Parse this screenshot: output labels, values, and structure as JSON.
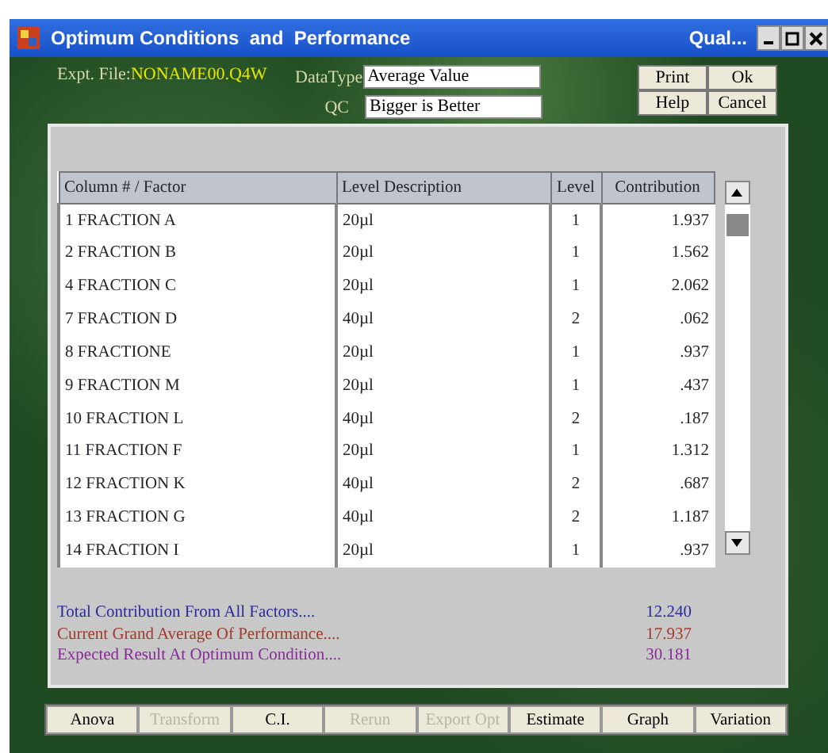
{
  "window": {
    "title": "Optimum Conditions  and  Performance",
    "title_right": "Qual..."
  },
  "header": {
    "file_label": "Expt. File:",
    "file_name": "NONAME00.Q4W",
    "datatype_label": "DataType",
    "datatype": "Average Value",
    "qc_label": "QC",
    "qc": "Bigger is Better"
  },
  "top_buttons": [
    "Print",
    "Ok",
    "Help",
    "Cancel"
  ],
  "table": {
    "columns": [
      "Column # / Factor",
      "Level Description",
      "Level",
      "Contribution"
    ],
    "rows": [
      [
        "1 FRACTION A",
        "20µl",
        "1",
        "1.937"
      ],
      [
        "2 FRACTION B",
        "20µl",
        "1",
        "1.562"
      ],
      [
        "4 FRACTION C",
        "20µl",
        "1",
        "2.062"
      ],
      [
        "7 FRACTION D",
        "40µl",
        "2",
        ".062"
      ],
      [
        "8 FRACTIONE",
        "20µl",
        "1",
        ".937"
      ],
      [
        "9 FRACTION M",
        "20µl",
        "1",
        ".437"
      ],
      [
        "10 FRACTION L",
        "40µl",
        "2",
        ".187"
      ],
      [
        "11 FRACTION F",
        "20µl",
        "1",
        "1.312"
      ],
      [
        "12 FRACTION K",
        "40µl",
        "2",
        ".687"
      ],
      [
        "13 FRACTION G",
        "40µl",
        "2",
        "1.187"
      ],
      [
        "14 FRACTION I",
        "20µl",
        "1",
        ".937"
      ]
    ]
  },
  "summary": [
    {
      "label": "Total Contribution From All Factors....",
      "value": "12.240",
      "color": "#2a2a9a"
    },
    {
      "label": "Current Grand Average Of Performance....",
      "value": "17.937",
      "color": "#a03a2a"
    },
    {
      "label": "Expected Result At Optimum Condition....",
      "value": "30.181",
      "color": "#8a2a9a"
    }
  ],
  "bottom_buttons": [
    {
      "label": "Anova",
      "disabled": false
    },
    {
      "label": "Transform",
      "disabled": true
    },
    {
      "label": "C.I.",
      "disabled": false
    },
    {
      "label": "Rerun",
      "disabled": true
    },
    {
      "label": "Export Opt",
      "disabled": true
    },
    {
      "label": "Estimate",
      "disabled": false
    },
    {
      "label": "Graph",
      "disabled": false
    },
    {
      "label": "Variation",
      "disabled": false
    }
  ]
}
